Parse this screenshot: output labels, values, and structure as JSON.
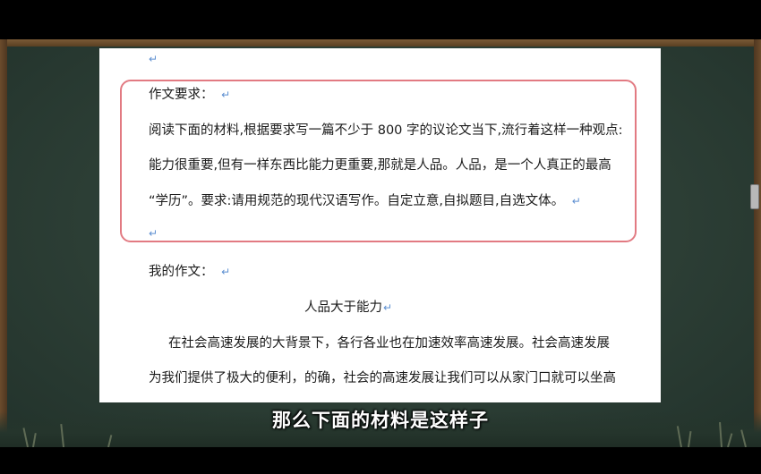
{
  "document": {
    "requirement_heading": "作文要求：",
    "requirement_lines": [
      "阅读下面的材料,根据要求写一篇不少于 800 字的议论文当下,流行着这样一种观点:",
      "能力很重要,但有一样东西比能力更重要,那就是人品。人品，是一个人真正的最高",
      "“学历”。要求:请用规范的现代汉语写作。自定立意,自拟题目,自选文体。"
    ],
    "my_essay_heading": "我的作文：",
    "essay_title": "人品大于能力",
    "essay_lines": [
      "在社会高速发展的大背景下，各行各业也在加速效率高速发展。社会高速发展",
      "为我们提供了极大的便利，的确，社会的高速发展让我们可以从家门口就可以坐高"
    ],
    "paragraph_mark": "↵"
  },
  "subtitle": {
    "text": "那么下面的材料是这样子"
  },
  "colors": {
    "highlight_box": "#e27a82",
    "paragraph_mark": "#5d8fd1",
    "board": "#2c3e35"
  }
}
